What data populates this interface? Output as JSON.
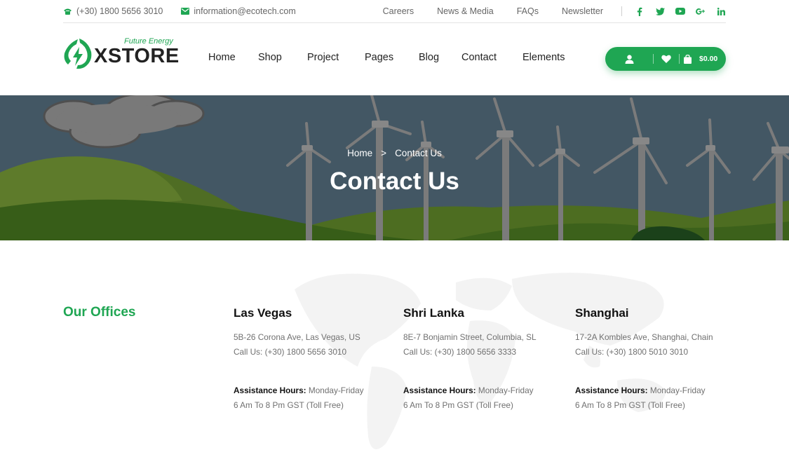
{
  "topbar": {
    "phone": "(+30) 1800 5656 3010",
    "email": "information@ecotech.com",
    "links": [
      "Careers",
      "News & Media",
      "FAQs",
      "Newsletter"
    ],
    "socials": [
      "facebook-icon",
      "twitter-icon",
      "youtube-icon",
      "google-plus-icon",
      "linkedin-icon"
    ]
  },
  "header": {
    "brand": "XSTORE",
    "tagline": "Future Energy",
    "nav": [
      "Home",
      "Shop",
      "Project",
      "Pages",
      "Blog",
      "Contact",
      "Elements"
    ],
    "cart_amount": "$0.00"
  },
  "hero": {
    "breadcrumb": [
      "Home",
      "Contact Us"
    ],
    "breadcrumb_separator": ">",
    "title": "Contact Us"
  },
  "offices": {
    "section_title": "Our Offices",
    "items": [
      {
        "city": "Las Vegas",
        "address": "5B-26 Corona Ave, Las Vegas, US",
        "phone": "Call Us: (+30) 1800 5656 3010",
        "hours_label": "Assistance Hours:",
        "hours_days": "Monday-Friday",
        "hours_time": "6 Am To 8 Pm GST (Toll Free)"
      },
      {
        "city": "Shri Lanka",
        "address": "8E-7 Bonjamin Street, Columbia, SL",
        "phone": "Call Us: (+30) 1800 5656 3333",
        "hours_label": "Assistance Hours:",
        "hours_days": "Monday-Friday",
        "hours_time": "6 Am To 8 Pm GST (Toll Free)"
      },
      {
        "city": "Shanghai",
        "address": "17-2A Kombles Ave, Shanghai, Chain",
        "phone": "Call Us: (+30) 1800 5010 3010",
        "hours_label": "Assistance Hours:",
        "hours_days": "Monday-Friday",
        "hours_time": "6 Am To 8 Pm GST (Toll Free)"
      }
    ]
  },
  "colors": {
    "accent": "#1fa653",
    "text_dark": "#222222",
    "text_muted": "#707070",
    "hero_sky": "#4d6472",
    "hero_hill": "#4a7a22"
  }
}
